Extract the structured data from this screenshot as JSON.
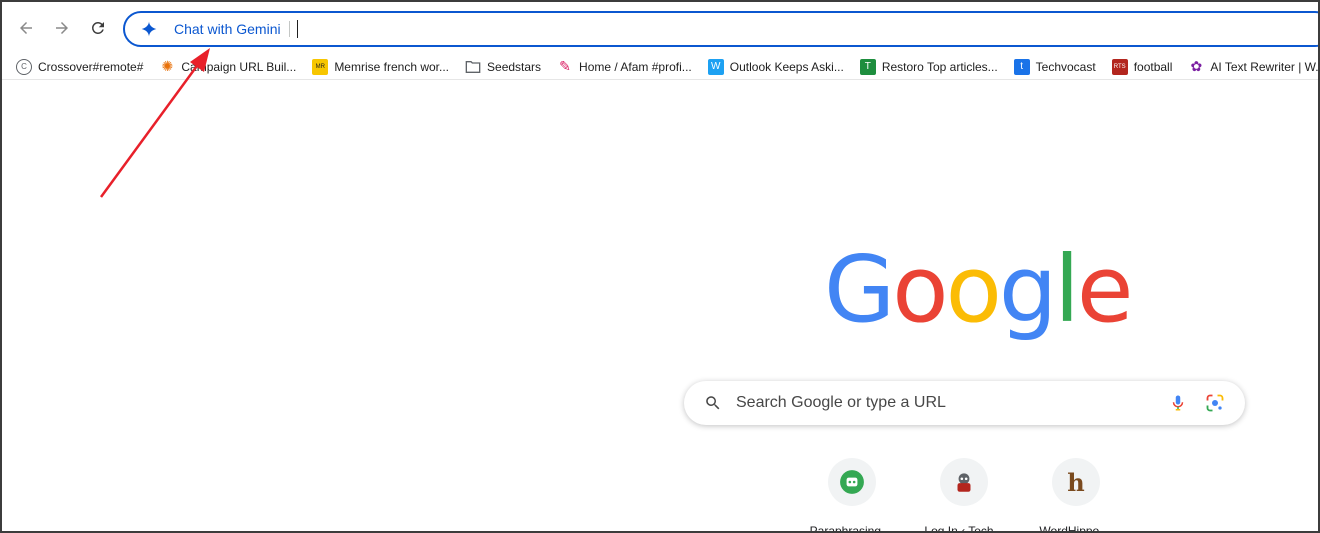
{
  "toolbar": {
    "omnibox": {
      "label": "Chat with Gemini",
      "value": ""
    }
  },
  "bookmarks": [
    {
      "label": "Crossover#remote#",
      "icon": "crossover-icon",
      "color": "#5f6368"
    },
    {
      "label": "Campaign URL Buil...",
      "icon": "campaign-url-builder-icon",
      "color": "#e8710a"
    },
    {
      "label": "Memrise french wor...",
      "icon": "memrise-icon",
      "color": "#f7c600"
    },
    {
      "label": "Seedstars",
      "icon": "folder-icon",
      "color": "#5f6368"
    },
    {
      "label": "Home / Afam #profi...",
      "icon": "feather-icon",
      "color": "#d81b60"
    },
    {
      "label": "Outlook Keeps Aski...",
      "icon": "wordpress-w-icon",
      "color": "#1da1f2"
    },
    {
      "label": "Restoro Top articles...",
      "icon": "restoro-icon",
      "color": "#1e8e3e"
    },
    {
      "label": "Techvocast",
      "icon": "techvocast-icon",
      "color": "#1a73e8"
    },
    {
      "label": "football",
      "icon": "rts-icon",
      "color": "#b3261e"
    },
    {
      "label": "AI Text Rewriter | W...",
      "icon": "ai-rewriter-icon",
      "color": "#7b1fa2"
    }
  ],
  "google": {
    "logo_letters": [
      "G",
      "o",
      "o",
      "g",
      "l",
      "e"
    ],
    "logo_colors": [
      "#4285f4",
      "#ea4335",
      "#fbbc05",
      "#4285f4",
      "#34a853",
      "#ea4335"
    ],
    "search_placeholder": "Search Google or type a URL"
  },
  "shortcuts": [
    {
      "label": "Paraphrasing ...",
      "icon": "paraphrasing-bot-icon"
    },
    {
      "label": "Log In ‹ Tech...",
      "icon": "log-in-tech-icon"
    },
    {
      "label": "WordHippo ...",
      "icon": "wordhippo-h-icon"
    }
  ],
  "annotation_color": "#e8202a"
}
